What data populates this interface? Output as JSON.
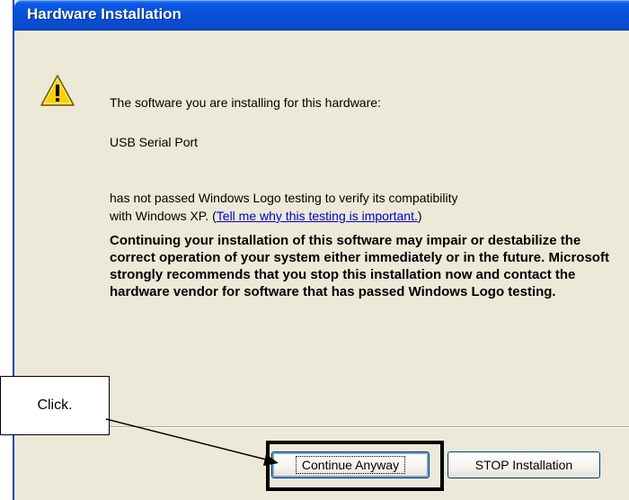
{
  "window": {
    "title": "Hardware Installation",
    "icon": "warning-icon"
  },
  "message": {
    "intro": "The software you are installing for this hardware:",
    "device_name": "USB Serial Port",
    "logo_text_line1": "has not passed Windows Logo testing to verify its compatibility",
    "logo_text_line2_prefix": "with Windows XP. (",
    "link_text": "Tell me why this testing is important.",
    "logo_text_line2_suffix": ")",
    "warning": "Continuing your installation of this software may impair or destabilize the correct operation of your system either immediately or in the future. Microsoft strongly recommends that you stop this installation now and contact the hardware vendor for software that has passed Windows Logo testing."
  },
  "buttons": {
    "continue_label": "Continue Anyway",
    "stop_label": "STOP Installation"
  },
  "annotation": {
    "callout_text": "Click."
  },
  "colors": {
    "titlebar": "#0a4fd6",
    "dialog_bg": "#ece9d8",
    "link": "#0000cc"
  }
}
